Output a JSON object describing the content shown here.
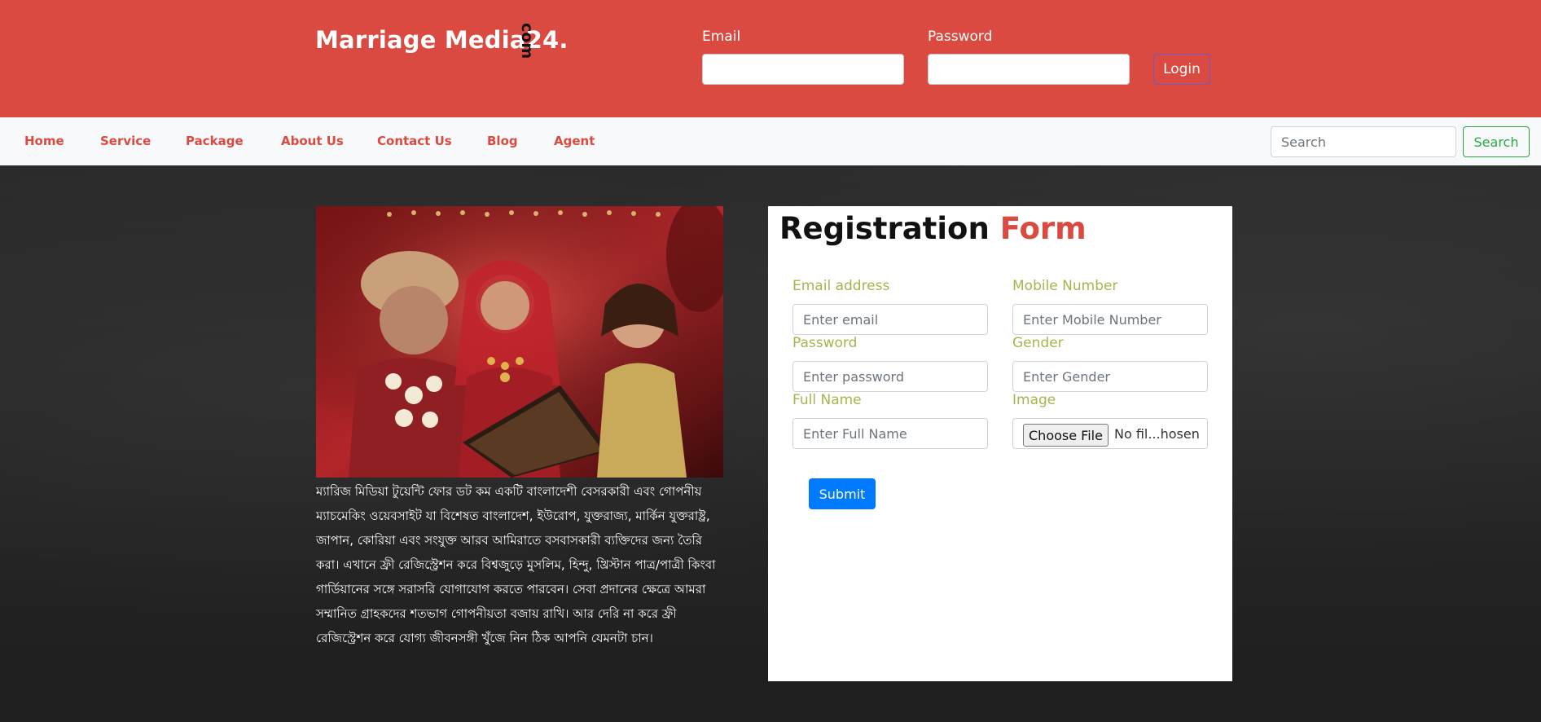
{
  "header": {
    "brand": "Marriage Media24.",
    "brand_suffix": "com",
    "email_label": "Email",
    "password_label": "Password",
    "login_button": "Login"
  },
  "nav": {
    "items": [
      "Home",
      "Service",
      "Package",
      "About Us",
      "Contact Us",
      "Blog",
      "Agent"
    ],
    "search_placeholder": "Search",
    "search_button": "Search"
  },
  "about": {
    "text": "ম্যারিজ মিডিয়া টুয়েন্টি ফোর ডট কম একটি বাংলাদেশী বেসরকারী এবং গোপনীয় ম্যাচমেকিং ওয়েবসাইট যা বিশেষত বাংলাদেশ, ইউরোপ, যুক্তরাজ্য, মার্কিন যুক্তরাষ্ট্র, জাপান, কোরিয়া এবং সংযুক্ত আরব আমিরাতে বসবাসকারী ব্যক্তিদের জন্য তৈরি করা। এখানে ফ্রী রেজিস্ট্রেশন করে বিশ্বজুড়ে মুসলিম, হিন্দু, খ্রিস্টান পাত্র/পাত্রী কিংবা গার্ডিয়ানের সঙ্গে সরাসরি যোগাযোগ করতে পারবেন। সেবা প্রদানের ক্ষেত্রে আমরা সম্মানিত গ্রাহকদের শতভাগ গোপনীয়তা বজায় রাখি। আর দেরি না করে ফ্রী রেজিস্ট্রেশন করে যোগ্য জীবনসঙ্গী খুঁজে নিন ঠিক আপনি যেমনটা চান।"
  },
  "registration": {
    "title": "Registration",
    "title_accent": "Form",
    "email_label": "Email address",
    "email_placeholder": "Enter email",
    "mobile_label": "Mobile Number",
    "mobile_placeholder": "Enter Mobile Number",
    "password_label": "Password",
    "password_placeholder": "Enter password",
    "gender_label": "Gender",
    "gender_placeholder": "Enter Gender",
    "fullname_label": "Full Name",
    "fullname_placeholder": "Enter Full Name",
    "image_label": "Image",
    "file_button": "Choose File",
    "file_status": "No fil...hosen",
    "submit": "Submit"
  },
  "colors": {
    "brand_red": "#db4a40",
    "label_olive": "#a6b54e",
    "primary_blue": "#007bff",
    "success_green": "#28a745"
  }
}
